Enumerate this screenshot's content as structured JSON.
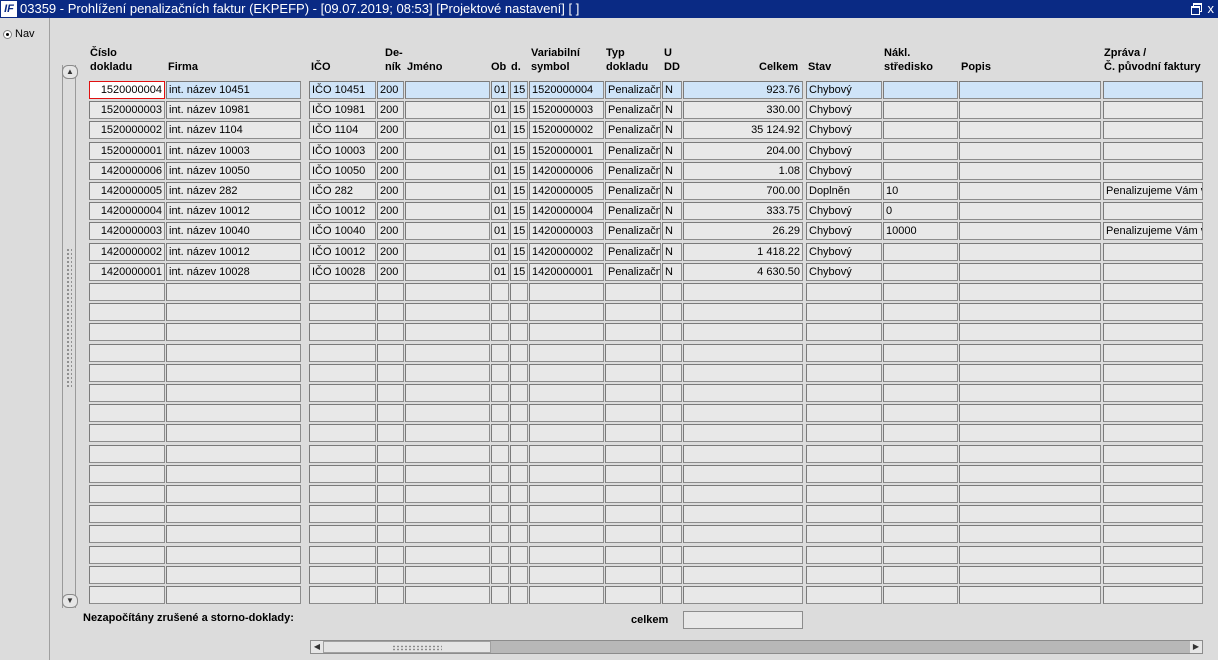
{
  "window": {
    "icon_label": "IF",
    "title": "03359 - Prohlížení penalizačních faktur (EKPEFP) - [09.07.2019; 08:53]  [Projektové nastavení]  [ ]",
    "close_glyph": "x"
  },
  "nav": {
    "label": "Nav"
  },
  "columns": [
    {
      "key": "cislo",
      "label": "Číslo\ndokladu"
    },
    {
      "key": "firma",
      "label": "Firma"
    },
    {
      "key": "ico",
      "label": "IČO"
    },
    {
      "key": "denik",
      "label": "De-\nník"
    },
    {
      "key": "jmeno",
      "label": "Jméno"
    },
    {
      "key": "ob",
      "label": "Ob"
    },
    {
      "key": "d",
      "label": "d."
    },
    {
      "key": "vs",
      "label": "Variabilní\nsymbol"
    },
    {
      "key": "typ",
      "label": "Typ\ndokladu"
    },
    {
      "key": "udd",
      "label": "U\nDD"
    },
    {
      "key": "celkem",
      "label": "Celkem"
    },
    {
      "key": "stav",
      "label": "Stav"
    },
    {
      "key": "nakl",
      "label": "Nákl.\nstředisko"
    },
    {
      "key": "popis",
      "label": "Popis"
    },
    {
      "key": "zprava",
      "label": "Zpráva /\nČ. původní faktury"
    }
  ],
  "rows": [
    {
      "cislo": "1520000004",
      "firma": "int. název 10451",
      "ico": "IČO 10451",
      "denik": "200",
      "jmeno": "",
      "ob": "01",
      "d": "15",
      "vs": "1520000004",
      "typ": "Penalizačn",
      "udd": "N",
      "celkem": "923.76",
      "stav": "Chybový",
      "nakl": "",
      "popis": "",
      "zprava": ""
    },
    {
      "cislo": "1520000003",
      "firma": "int. název 10981",
      "ico": "IČO 10981",
      "denik": "200",
      "jmeno": "",
      "ob": "01",
      "d": "15",
      "vs": "1520000003",
      "typ": "Penalizačn",
      "udd": "N",
      "celkem": "330.00",
      "stav": "Chybový",
      "nakl": "",
      "popis": "",
      "zprava": ""
    },
    {
      "cislo": "1520000002",
      "firma": "int. název 1104",
      "ico": "IČO 1104",
      "denik": "200",
      "jmeno": "",
      "ob": "01",
      "d": "15",
      "vs": "1520000002",
      "typ": "Penalizačn",
      "udd": "N",
      "celkem": "35 124.92",
      "stav": "Chybový",
      "nakl": "",
      "popis": "",
      "zprava": ""
    },
    {
      "cislo": "1520000001",
      "firma": "int. název 10003",
      "ico": "IČO 10003",
      "denik": "200",
      "jmeno": "",
      "ob": "01",
      "d": "15",
      "vs": "1520000001",
      "typ": "Penalizačn",
      "udd": "N",
      "celkem": "204.00",
      "stav": "Chybový",
      "nakl": "",
      "popis": "",
      "zprava": ""
    },
    {
      "cislo": "1420000006",
      "firma": "int. název 10050",
      "ico": "IČO 10050",
      "denik": "200",
      "jmeno": "",
      "ob": "01",
      "d": "15",
      "vs": "1420000006",
      "typ": "Penalizačn",
      "udd": "N",
      "celkem": "1.08",
      "stav": "Chybový",
      "nakl": "",
      "popis": "",
      "zprava": ""
    },
    {
      "cislo": "1420000005",
      "firma": "int. název 282",
      "ico": "IČO 282",
      "denik": "200",
      "jmeno": "",
      "ob": "01",
      "d": "15",
      "vs": "1420000005",
      "typ": "Penalizačn",
      "udd": "N",
      "celkem": "700.00",
      "stav": "Doplněn",
      "nakl": "10",
      "popis": "",
      "zprava": "Penalizujeme Vám v"
    },
    {
      "cislo": "1420000004",
      "firma": "int. název 10012",
      "ico": "IČO 10012",
      "denik": "200",
      "jmeno": "",
      "ob": "01",
      "d": "15",
      "vs": "1420000004",
      "typ": "Penalizačn",
      "udd": "N",
      "celkem": "333.75",
      "stav": "Chybový",
      "nakl": "0",
      "popis": "",
      "zprava": ""
    },
    {
      "cislo": "1420000003",
      "firma": "int. název 10040",
      "ico": "IČO 10040",
      "denik": "200",
      "jmeno": "",
      "ob": "01",
      "d": "15",
      "vs": "1420000003",
      "typ": "Penalizačn",
      "udd": "N",
      "celkem": "26.29",
      "stav": "Chybový",
      "nakl": "10000",
      "popis": "",
      "zprava": "Penalizujeme Vám v"
    },
    {
      "cislo": "1420000002",
      "firma": "int. název 10012",
      "ico": "IČO 10012",
      "denik": "200",
      "jmeno": "",
      "ob": "01",
      "d": "15",
      "vs": "1420000002",
      "typ": "Penalizačn",
      "udd": "N",
      "celkem": "1 418.22",
      "stav": "Chybový",
      "nakl": "",
      "popis": "",
      "zprava": ""
    },
    {
      "cislo": "1420000001",
      "firma": "int. název 10028",
      "ico": "IČO 10028",
      "denik": "200",
      "jmeno": "",
      "ob": "01",
      "d": "15",
      "vs": "1420000001",
      "typ": "Penalizačn",
      "udd": "N",
      "celkem": "4 630.50",
      "stav": "Chybový",
      "nakl": "",
      "popis": "",
      "zprava": ""
    }
  ],
  "footer": {
    "note": "Nezapočítány zrušené a storno-doklady:",
    "total_label": "celkem",
    "total_value": ""
  }
}
